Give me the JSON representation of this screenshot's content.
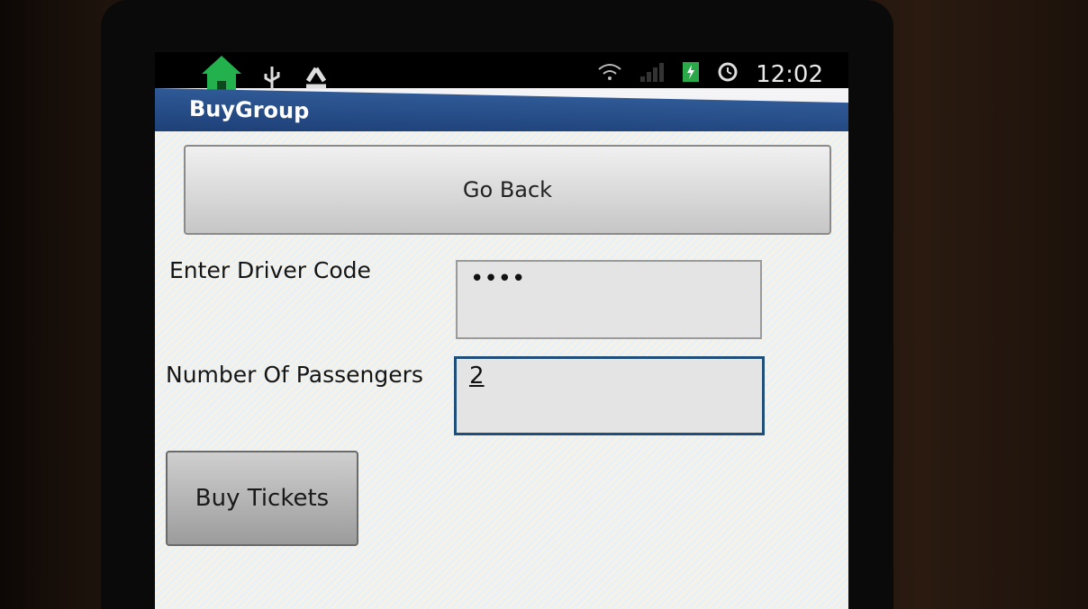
{
  "status_bar": {
    "time": "12:02",
    "icons": [
      "home-icon",
      "usb-icon",
      "recycle-icon",
      "wifi-icon",
      "signal-icon",
      "battery-charging-icon",
      "alarm-icon"
    ]
  },
  "app": {
    "title": "BuyGroup"
  },
  "buttons": {
    "go_back": "Go Back",
    "buy_tickets": "Buy Tickets"
  },
  "form": {
    "driver_code": {
      "label": "Enter Driver Code",
      "value": "••••"
    },
    "passengers": {
      "label": "Number Of Passengers",
      "value": "2"
    }
  },
  "colors": {
    "titlebar": "#1e4078",
    "home_icon": "#22b14c",
    "focus_border": "#1f4e79"
  }
}
